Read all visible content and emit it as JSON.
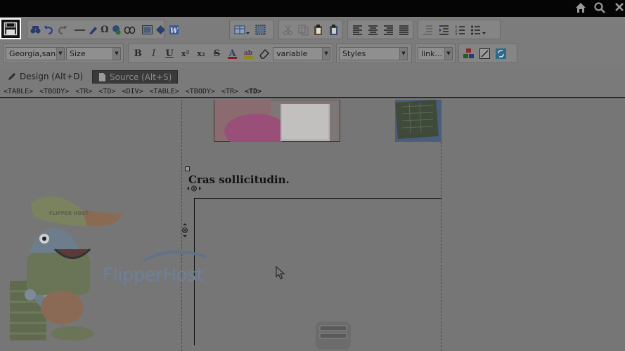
{
  "window": {
    "top_icons": [
      "home-icon",
      "search-icon",
      "close-icon"
    ]
  },
  "toolbar": {
    "font_family": "Georgia,san",
    "font_size": "Size",
    "variable": "variable",
    "styles": "Styles",
    "link": "link..."
  },
  "tabs": {
    "design": "Design (Alt+D)",
    "source": "Source (Alt+S)"
  },
  "path": [
    "<TABLE>",
    "<TBODY>",
    "<TR>",
    "<TD>",
    "<DIV>",
    "<TABLE>",
    "<TBODY>",
    "<TR>",
    "<TD>"
  ],
  "content": {
    "heading": "Cras sollicitudin.",
    "logo_text": "FlipperHost",
    "mascot_cap_text": "FLIPPER HOST"
  }
}
